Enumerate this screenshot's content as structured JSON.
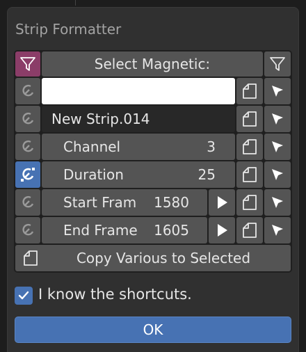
{
  "dialog": {
    "title": "Strip Formatter"
  },
  "panel": {
    "header_label": "Select Magnetic:",
    "name_field_value": "",
    "strip_name": "New Strip.014",
    "rows": [
      {
        "label": "Channel",
        "value": "3"
      },
      {
        "label": "Duration",
        "value": "25"
      },
      {
        "label": "Start Fram",
        "value": "1580"
      },
      {
        "label": "End Frame",
        "value": "1605"
      }
    ],
    "copy_label": "Copy Various to Selected"
  },
  "checkbox": {
    "label": "I know the shortcuts.",
    "checked": true
  },
  "ok_label": "OK",
  "colors": {
    "accent": "#4772b3",
    "filter_active": "#8b3d68",
    "background": "#303030"
  },
  "icons": [
    "filter-icon",
    "magnet-icon",
    "copy-icon",
    "cursor-icon",
    "play-icon",
    "checkmark-icon"
  ]
}
